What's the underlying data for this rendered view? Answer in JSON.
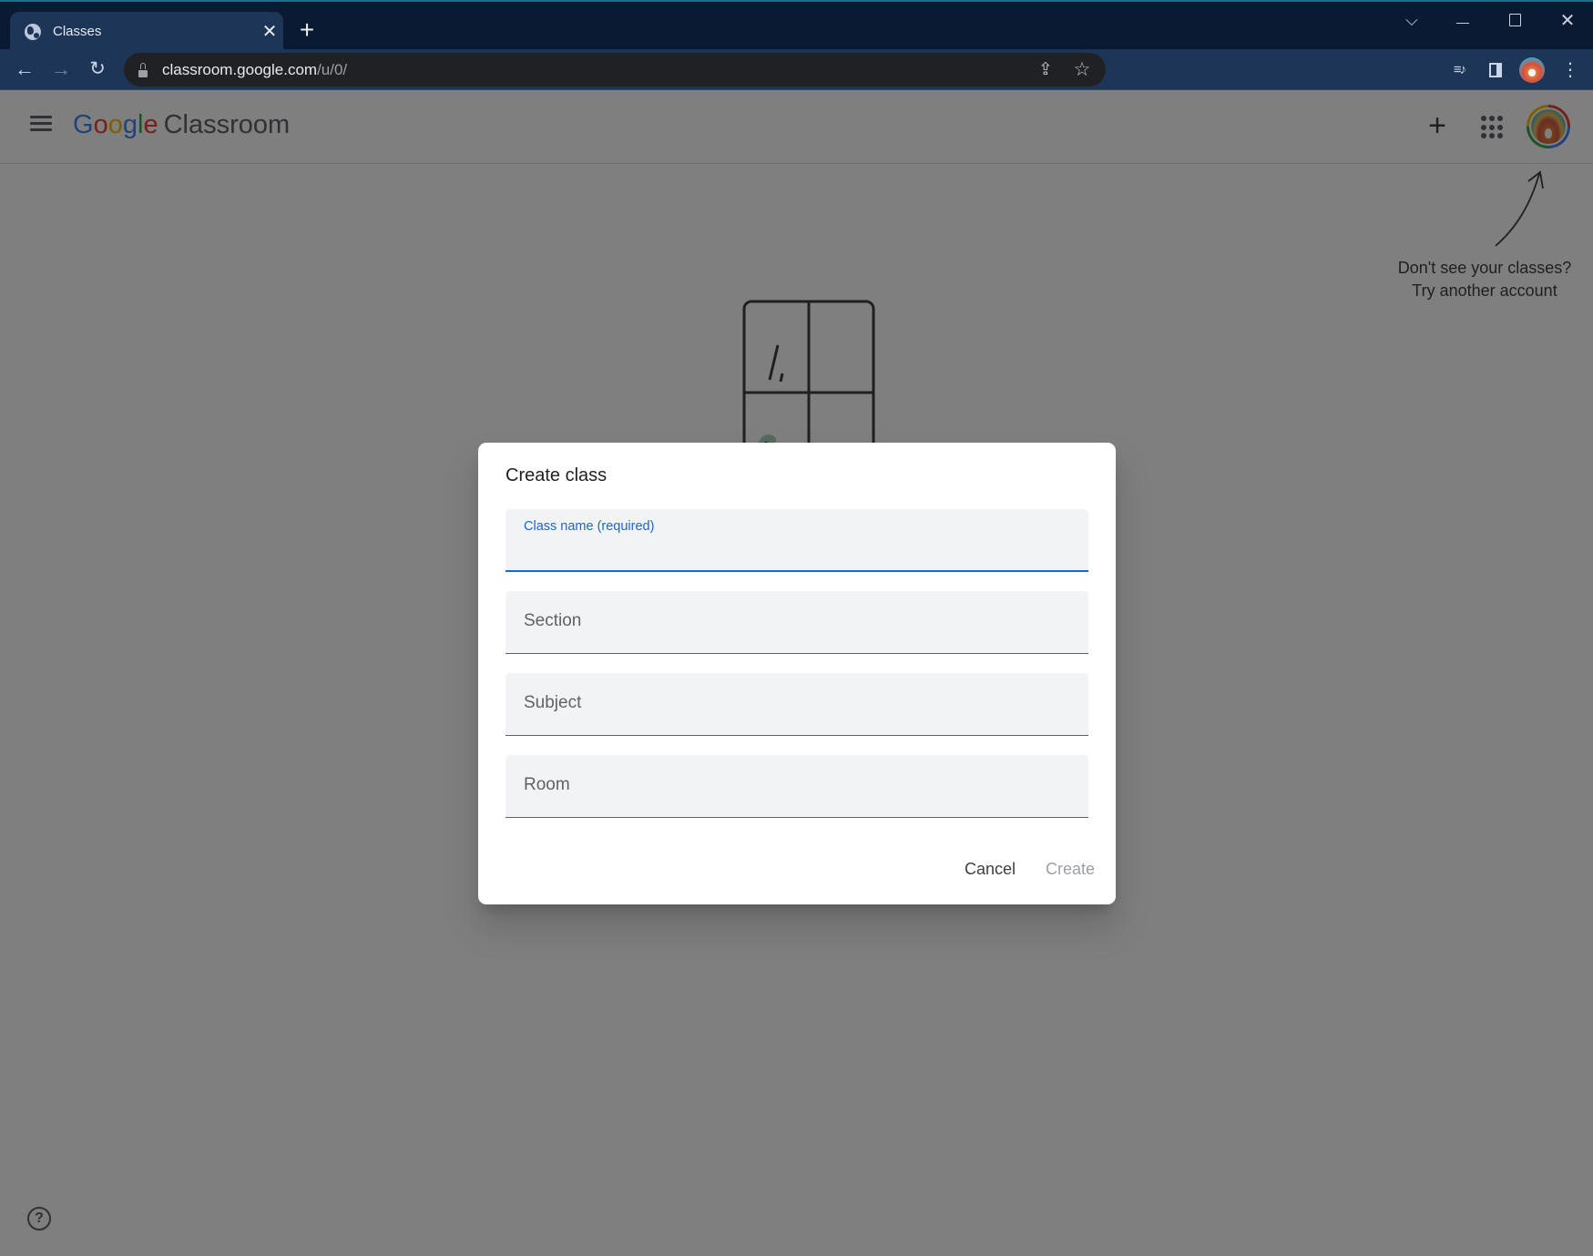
{
  "browser": {
    "tab": {
      "title": "Classes",
      "favicon": "globe-icon",
      "close_glyph": "✕"
    },
    "new_tab_glyph": "+",
    "window_controls": {
      "tab_search": "⌵",
      "minimize": "",
      "maximize": "",
      "close": "✕"
    },
    "nav": {
      "back": "←",
      "forward": "→",
      "reload": "↻"
    },
    "address": {
      "host": "classroom.google.com",
      "path": "/u/0/"
    },
    "omnibox_icons": {
      "share": "⇪",
      "bookmark": "☆"
    },
    "toolbar_icons": {
      "media": "≡♪",
      "menu": "⋮"
    }
  },
  "app": {
    "brand": {
      "letters": [
        "G",
        "o",
        "o",
        "g",
        "l",
        "e"
      ],
      "product": "Classroom"
    },
    "header": {
      "create_glyph": "+"
    },
    "hint": {
      "line1": "Don't see your classes?",
      "line2": "Try another account"
    },
    "help_glyph": "?"
  },
  "dialog": {
    "title": "Create class",
    "fields": [
      {
        "label": "Class name (required)",
        "value": "",
        "state": "focused"
      },
      {
        "label": "Section",
        "value": ""
      },
      {
        "label": "Subject",
        "value": ""
      },
      {
        "label": "Room",
        "value": ""
      }
    ],
    "cancel_label": "Cancel",
    "create_label": "Create",
    "create_enabled": false
  }
}
